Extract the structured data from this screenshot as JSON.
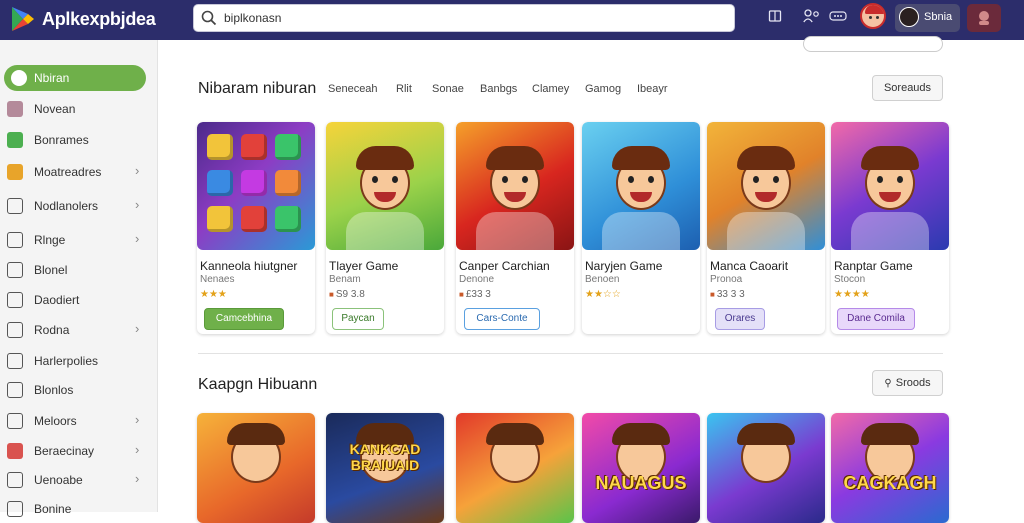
{
  "app": {
    "brand": "Aplkexpbjdea"
  },
  "search": {
    "value": "biplkonasn"
  },
  "topbar": {
    "user_label": "Sbnia",
    "icons": [
      "book-icon",
      "people-icon",
      "chat-icon"
    ]
  },
  "sidebar": {
    "items": [
      {
        "label": "Nbiran",
        "icon": "home-icon",
        "color": "#ffffff",
        "active": true,
        "chevron": false
      },
      {
        "label": "Novean",
        "icon": "store-icon",
        "color": "#b48a9a",
        "chevron": false
      },
      {
        "label": "Bonrames",
        "icon": "check-icon",
        "color": "#4caf50",
        "chevron": false
      },
      {
        "label": "Moatreadres",
        "icon": "grid-icon",
        "color": "#e8a42a",
        "chevron": true
      },
      {
        "label": "Nodlanolers",
        "icon": "mail-icon",
        "color": "#555555",
        "chevron": true
      },
      {
        "label": "Rlnge",
        "icon": "chart-icon",
        "color": "#555555",
        "chevron": true
      },
      {
        "label": "Blonel",
        "icon": "bookmark-icon",
        "color": "#555555",
        "chevron": false
      },
      {
        "label": "Daodiert",
        "icon": "camera-icon",
        "color": "#555555",
        "chevron": false
      },
      {
        "label": "Rodna",
        "icon": "doc-icon",
        "color": "#555555",
        "chevron": true
      },
      {
        "label": "Harlerpolies",
        "icon": "monitor-icon",
        "color": "#555555",
        "chevron": false
      },
      {
        "label": "Blonlos",
        "icon": "folder-icon",
        "color": "#555555",
        "chevron": false
      },
      {
        "label": "Meloors",
        "icon": "bars-icon",
        "color": "#555555",
        "chevron": true
      },
      {
        "label": "Beraecinay",
        "icon": "play-icon",
        "color": "#d9534f",
        "chevron": true
      },
      {
        "label": "Uenoabe",
        "icon": "tv-icon",
        "color": "#555555",
        "chevron": true
      },
      {
        "label": "Bonine",
        "icon": "star-icon",
        "color": "#555555",
        "chevron": false
      }
    ]
  },
  "section1": {
    "title": "Nibaram niburan",
    "tabs": [
      "Seneceah",
      "Rlit",
      "Sonae",
      "Banbgs",
      "Clamey",
      "Gamog",
      "Ibeayr"
    ],
    "action_label": "Soreauds",
    "cards": [
      {
        "name": "Kanneola hiutgner",
        "sub": "Nenaes",
        "rating": "★★★",
        "rating_num": "",
        "cta": "Camcebhina",
        "cta_style": "green",
        "art": "puzzle"
      },
      {
        "name": "Tlayer Game",
        "sub": "Benam",
        "rating": "■",
        "rating_num": "S9 3.8",
        "cta": "Paycan",
        "cta_style": "outline-green",
        "art": "cartoon-yellow"
      },
      {
        "name": "Canper Carchian",
        "sub": "Denone",
        "rating": "■",
        "rating_num": "£33 3",
        "cta": "Cars-Conte",
        "cta_style": "outline-blue",
        "art": "cartoon-red"
      },
      {
        "name": "Naryjen Game",
        "sub": "Benoen",
        "rating": "★★☆☆",
        "rating_num": "",
        "cta": "",
        "cta_style": "none",
        "art": "cartoon-blue"
      },
      {
        "name": "Manca Caoarit",
        "sub": "Pronoa",
        "rating": "■",
        "rating_num": "33 3 3",
        "cta": "Orares",
        "cta_style": "lavender",
        "art": "cartoon-orange"
      },
      {
        "name": "Ranptar Game",
        "sub": "Stocon",
        "rating": "★★★★",
        "rating_num": "",
        "cta": "Dane Comila",
        "cta_style": "purple",
        "art": "cartoon-purple"
      }
    ]
  },
  "section2": {
    "title": "Kaapgn Hibuann",
    "action_label": "Sroods",
    "cards": [
      {
        "label": "",
        "art": "orange"
      },
      {
        "label": "KANKCAD BRAIUAID",
        "art": "navy"
      },
      {
        "label": "",
        "art": "red-orange"
      },
      {
        "label": "NAUAGUS",
        "art": "pink-purple"
      },
      {
        "label": "",
        "art": "blue"
      },
      {
        "label": "CAGKAGH",
        "art": "violet"
      }
    ]
  }
}
